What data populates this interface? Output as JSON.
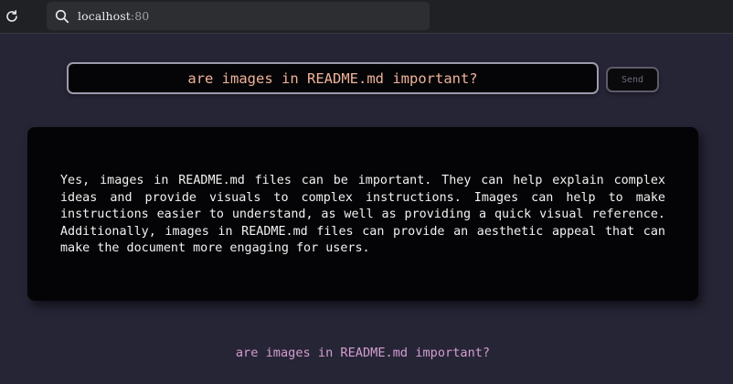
{
  "browser": {
    "url_host": "localhost",
    "url_port": ":80"
  },
  "query": {
    "value": "are images in README.md important?",
    "send_label": "Send"
  },
  "answer": {
    "text": "Yes, images in README.md files can be important. They can help explain complex ideas and provide visuals to complex instructions. Images can help to make instructions easier to understand, as well as providing a quick visual reference. Additionally, images in README.md files can provide an aesthetic appeal that can make the document more engaging for users."
  },
  "history": {
    "question": "are images in README.md important?"
  },
  "colors": {
    "page_bg": "#262536",
    "input_text": "#f0b29a",
    "echo_text": "#d39ed0",
    "card_bg": "#040406"
  }
}
